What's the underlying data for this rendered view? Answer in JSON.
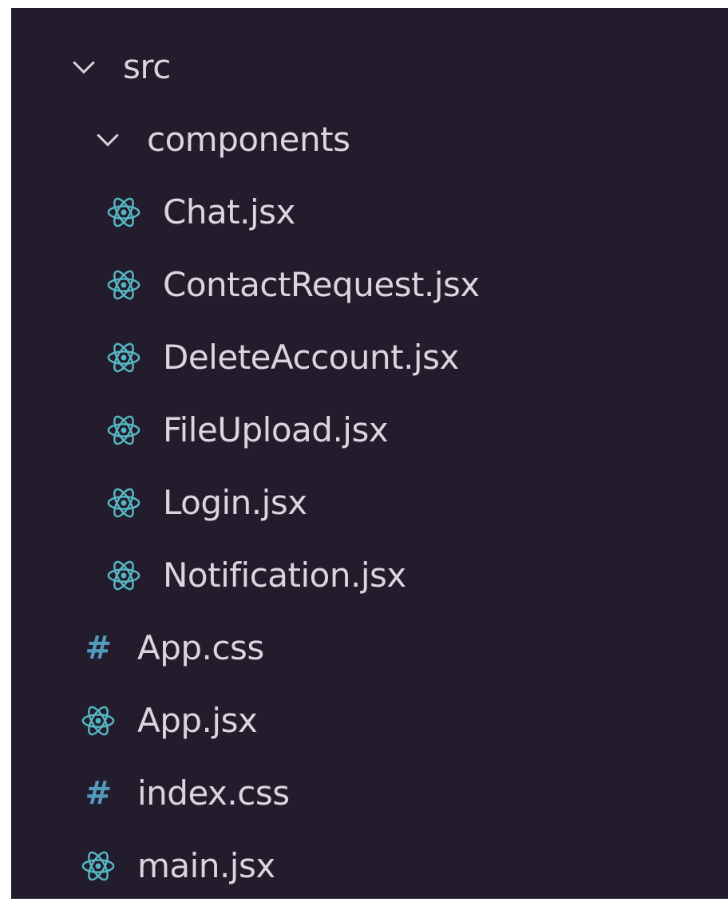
{
  "explorer": {
    "folder_src": {
      "label": "src",
      "icon": "chevron-down-icon"
    },
    "folder_components": {
      "label": "components",
      "icon": "chevron-down-icon"
    },
    "component_files": [
      {
        "label": "Chat.jsx",
        "icon": "react-icon"
      },
      {
        "label": "ContactRequest.jsx",
        "icon": "react-icon"
      },
      {
        "label": "DeleteAccount.jsx",
        "icon": "react-icon"
      },
      {
        "label": "FileUpload.jsx",
        "icon": "react-icon"
      },
      {
        "label": "Login.jsx",
        "icon": "react-icon"
      },
      {
        "label": "Notification.jsx",
        "icon": "react-icon"
      }
    ],
    "src_files": [
      {
        "label": "App.css",
        "icon": "hash-icon",
        "glyph": "#"
      },
      {
        "label": "App.jsx",
        "icon": "react-icon"
      },
      {
        "label": "index.css",
        "icon": "hash-icon",
        "glyph": "#"
      },
      {
        "label": "main.jsx",
        "icon": "react-icon"
      }
    ]
  },
  "colors": {
    "background": "#221c2c",
    "text": "#d9d6df",
    "react_icon": "#56b6c2",
    "css_icon": "#519aba"
  }
}
